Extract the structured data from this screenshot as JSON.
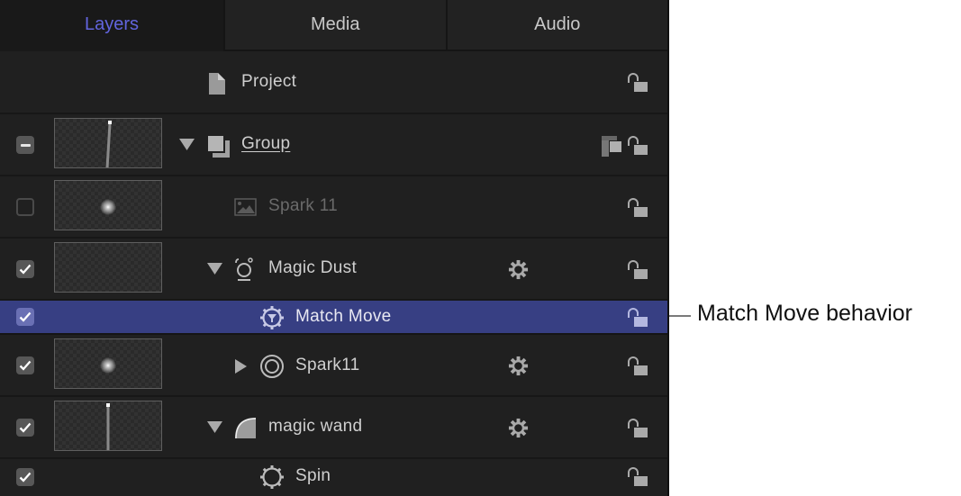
{
  "tabs": [
    {
      "label": "Layers",
      "active": true
    },
    {
      "label": "Media",
      "active": false
    },
    {
      "label": "Audio",
      "active": false
    }
  ],
  "colors": {
    "accent": "#6265de",
    "selection": "#373f83",
    "panel_bg": "#202020"
  },
  "layers": [
    {
      "name": "Project",
      "type": "project",
      "icon": "document-icon",
      "lock": "unlocked"
    },
    {
      "name": "Group",
      "type": "group",
      "icon": "group-icon",
      "checkbox": "mixed",
      "expanded": true,
      "has_thumbnail": true,
      "extra_icon": "layer-order-icon",
      "lock": "unlocked"
    },
    {
      "name": "Spark 11",
      "type": "image",
      "icon": "image-icon",
      "checkbox": "unchecked",
      "has_thumbnail": true,
      "dimmed": true,
      "lock": "unlocked"
    },
    {
      "name": "Magic Dust",
      "type": "emitter",
      "icon": "emitter-icon",
      "checkbox": "checked",
      "expanded": true,
      "has_thumbnail": true,
      "extra_icon": "behavior-gear-icon",
      "lock": "unlocked"
    },
    {
      "name": "Match Move",
      "type": "behavior",
      "icon": "match-move-behavior-icon",
      "checkbox": "checked",
      "selected": true,
      "lock": "unlocked"
    },
    {
      "name": "Spark11",
      "type": "replicator",
      "icon": "replicator-icon",
      "checkbox": "checked",
      "expanded": false,
      "has_thumbnail": true,
      "extra_icon": "behavior-gear-icon",
      "lock": "unlocked"
    },
    {
      "name": "magic wand",
      "type": "shape",
      "icon": "shape-icon",
      "checkbox": "checked",
      "expanded": true,
      "has_thumbnail": true,
      "extra_icon": "behavior-gear-icon",
      "lock": "unlocked"
    },
    {
      "name": "Spin",
      "type": "behavior",
      "icon": "spin-behavior-icon",
      "checkbox": "checked",
      "lock": "unlocked"
    }
  ],
  "callout": {
    "text": "Match Move behavior"
  }
}
